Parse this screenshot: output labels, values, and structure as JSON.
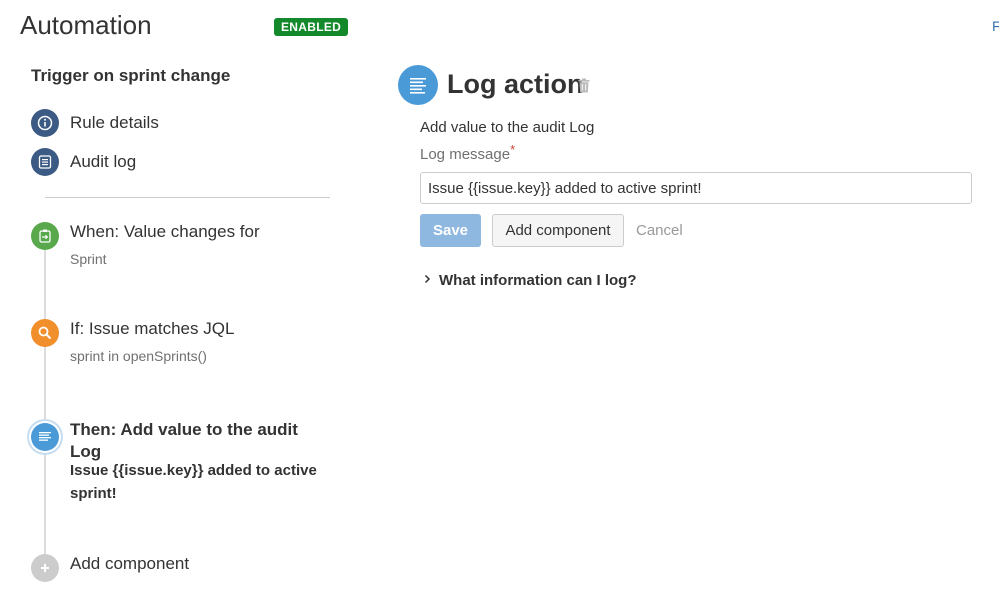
{
  "header": {
    "title": "Automation",
    "status_badge": "ENABLED",
    "edge_link": "F"
  },
  "sidebar": {
    "rule_name": "Trigger on sprint change",
    "nav_items": [
      {
        "label": "Rule details",
        "icon": "info-icon"
      },
      {
        "label": "Audit log",
        "icon": "list-icon"
      }
    ],
    "steps": [
      {
        "title": "When: Value changes for",
        "subtitle": "Sprint",
        "icon": "trigger-icon",
        "color": "#59a84b"
      },
      {
        "title": "If: Issue matches JQL",
        "subtitle": "sprint in openSprints()",
        "icon": "search-icon",
        "color": "#f18f2d"
      },
      {
        "title": "Then: Add value to the audit Log",
        "subtitle": "Issue {{issue.key}} added to active sprint!",
        "icon": "log-icon",
        "color": "#4a9ad8"
      }
    ],
    "add_component": "Add component"
  },
  "panel": {
    "title": "Log action",
    "description": "Add value to the audit Log",
    "field_label": "Log message",
    "required_marker": "*",
    "field_value": "Issue {{issue.key}} added to active sprint!",
    "save_label": "Save",
    "add_component_label": "Add component",
    "cancel_label": "Cancel",
    "help_expander": "What information can I log?"
  },
  "colors": {
    "enabled": "#14892c",
    "nav_icon": "#3b5a84",
    "accent": "#4a9ad8",
    "save_disabled": "#8fb8e0"
  }
}
